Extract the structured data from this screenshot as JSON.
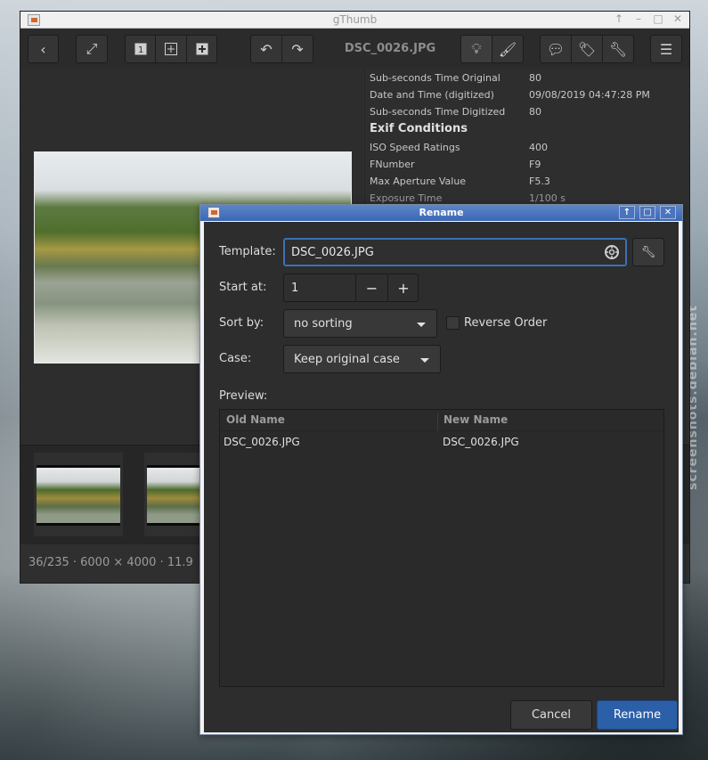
{
  "desktop": {
    "watermark": "screenshots.debian.net"
  },
  "main": {
    "title": "gThumb",
    "window_buttons": [
      "↑",
      "–",
      "□",
      "✕"
    ],
    "toolbar": {
      "filename": "DSC_0026.JPG",
      "icons": [
        "back-icon",
        "fullscreen-icon",
        "one-icon",
        "fit-icon",
        "zoom-in-icon",
        "rotate-left-icon",
        "rotate-right-icon",
        "lightbulb-icon",
        "brush-icon",
        "comment-icon",
        "tag-icon",
        "wrench-icon",
        "menu-icon"
      ]
    },
    "info_rows": [
      {
        "k": "Sub-seconds Time Original",
        "v": "80"
      },
      {
        "k": "Date and Time (digitized)",
        "v": "09/08/2019 04:47:28 PM"
      },
      {
        "k": "Sub-seconds Time Digitized",
        "v": "80"
      }
    ],
    "info_section": "Exif Conditions",
    "info_rows2": [
      {
        "k": "ISO Speed Ratings",
        "v": "400"
      },
      {
        "k": "FNumber",
        "v": "F9"
      },
      {
        "k": "Max Aperture Value",
        "v": "F5.3"
      },
      {
        "k": "Exposure Time",
        "v": "1/100 s"
      }
    ],
    "status": "36/235  ·  6000 × 4000  ·  11.9"
  },
  "dialog": {
    "title": "Rename",
    "template_label": "Template:",
    "template_value": "DSC_0026.JPG",
    "start_label": "Start at:",
    "start_value": "1",
    "sort_label": "Sort by:",
    "sort_value": "no sorting",
    "reverse_label": "Reverse Order",
    "reverse_checked": false,
    "case_label": "Case:",
    "case_value": "Keep original case",
    "preview_label": "Preview:",
    "columns": [
      "Old Name",
      "New Name"
    ],
    "rows": [
      {
        "old": "DSC_0026.JPG",
        "new": "DSC_0026.JPG"
      }
    ],
    "cancel_label": "Cancel",
    "rename_label": "Rename"
  }
}
